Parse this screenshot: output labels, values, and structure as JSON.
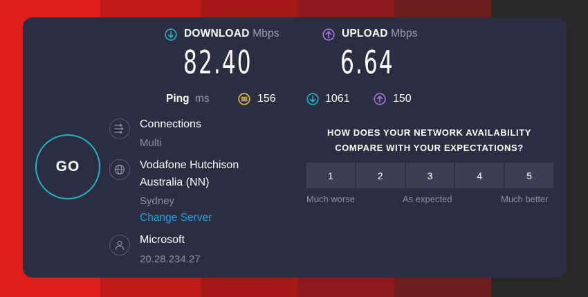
{
  "download": {
    "label": "DOWNLOAD",
    "unit": "Mbps",
    "value": "82.40",
    "icon": "download-arrow-icon",
    "color": "#1fb6c9"
  },
  "upload": {
    "label": "UPLOAD",
    "unit": "Mbps",
    "value": "6.64",
    "icon": "upload-arrow-icon",
    "color": "#a777e0"
  },
  "ping": {
    "label": "Ping",
    "unit": "ms",
    "idle": "156",
    "download": "1061",
    "upload": "150",
    "idle_color": "#e8c44a"
  },
  "go_button": {
    "label": "GO",
    "color": "#1fb6c9"
  },
  "connections": {
    "title": "Connections",
    "value": "Multi",
    "icon": "connections-icon"
  },
  "server": {
    "name_line1": "Vodafone Hutchison",
    "name_line2": "Australia (NN)",
    "location": "Sydney",
    "change_link": "Change Server",
    "icon": "globe-icon",
    "link_color": "#1ea7e4"
  },
  "host": {
    "title": "Microsoft",
    "ip": "20.28.234.27",
    "icon": "user-icon"
  },
  "survey": {
    "question_line1": "HOW DOES YOUR NETWORK AVAILABILITY",
    "question_line2": "COMPARE WITH YOUR EXPECTATIONS?",
    "options": [
      "1",
      "2",
      "3",
      "4",
      "5"
    ],
    "low_label": "Much worse",
    "mid_label": "As expected",
    "high_label": "Much better"
  },
  "colors": {
    "card": "#2b2d40",
    "background_red": "#e01e1e",
    "background_dark": "#2a2727"
  }
}
